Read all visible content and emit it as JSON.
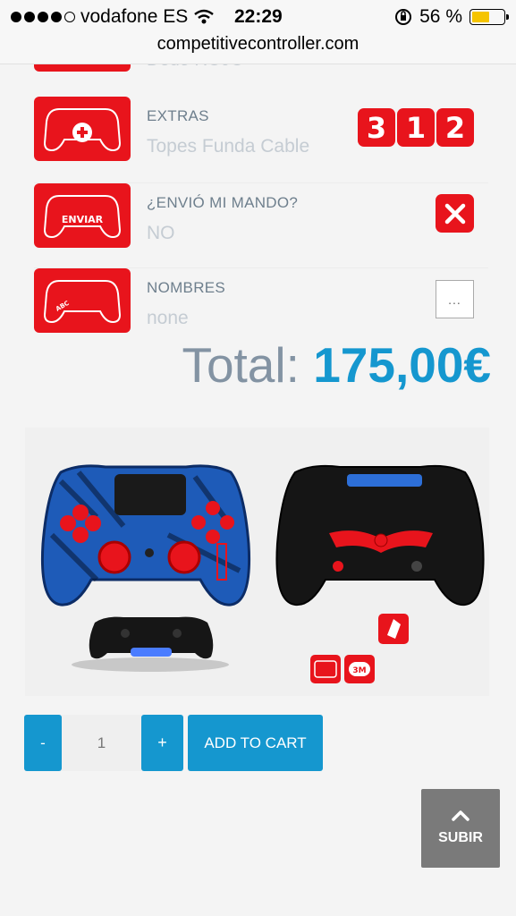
{
  "status_bar": {
    "carrier": "vodafone ES",
    "time": "22:29",
    "battery_percent": "56 %",
    "battery_level": 0.56,
    "signal_bars": 4
  },
  "browser": {
    "url": "competitivecontroller.com"
  },
  "partial_option": {
    "value": "Dedo ROJO"
  },
  "options": [
    {
      "label": "EXTRAS",
      "value": "Topes Funda Cable",
      "digits": [
        "3",
        "1",
        "2"
      ]
    },
    {
      "label": "¿ENVIÓ MI MANDO?",
      "value": "NO",
      "thumb_text": "ENVIAR"
    },
    {
      "label": "NOMBRES",
      "value": "none",
      "thumb_text": "ABC",
      "more_label": "..."
    }
  ],
  "total": {
    "label": "Total:",
    "amount": "175,00€"
  },
  "product_image": {
    "badge_text": "3M"
  },
  "cart": {
    "minus_label": "-",
    "quantity": "1",
    "plus_label": "+",
    "add_label": "ADD TO CART"
  },
  "scroll_top": {
    "label": "SUBIR"
  },
  "colors": {
    "accent_blue": "#1597cf",
    "brand_red": "#e8141c",
    "total_grey": "#8393a3"
  }
}
